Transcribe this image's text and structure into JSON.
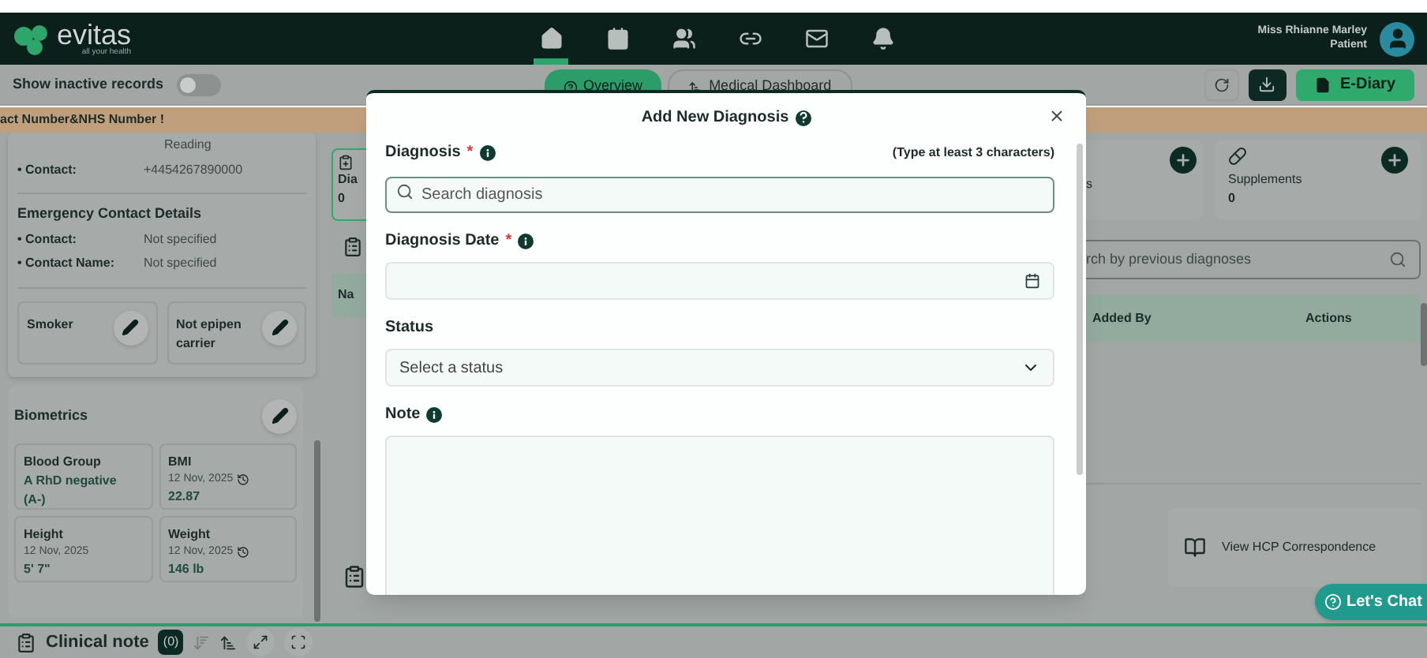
{
  "header": {
    "logo": "evitas",
    "tagline": "all your health",
    "nav": [
      {
        "kind": "home",
        "selected": true
      },
      {
        "kind": "calendar",
        "selected": false
      },
      {
        "kind": "people",
        "selected": false
      },
      {
        "kind": "link",
        "selected": false
      },
      {
        "kind": "mail",
        "selected": false
      },
      {
        "kind": "bell",
        "selected": false
      }
    ],
    "user": {
      "name": "Miss Rhianne Marley",
      "role": "Patient"
    }
  },
  "toolbar": {
    "inactive_toggle": {
      "label": "Show inactive records",
      "on": false
    },
    "tabs": [
      {
        "label": "Overview",
        "selected": true
      },
      {
        "label": "Medical Dashboard",
        "selected": false
      }
    ],
    "e_diary": "E-Diary"
  },
  "banner": "act Number&NHS Number !",
  "contact": {
    "reading": "Reading",
    "rows": [
      {
        "label": "• Contact:",
        "value": "+4454267890000"
      }
    ]
  },
  "emergency": {
    "title": "Emergency Contact Details",
    "rows": [
      {
        "label": "• Contact:",
        "value": "Not specified"
      },
      {
        "label": "• Contact Name:",
        "value": "Not specified"
      }
    ]
  },
  "flags": [
    "Smoker",
    "Not epipen carrier"
  ],
  "biometrics": {
    "title": "Biometrics",
    "items": [
      {
        "label": "Blood Group",
        "value": "A RhD negative (A-)",
        "history": false
      },
      {
        "label": "BMI",
        "date": "12 Nov, 2025",
        "value": "22.87",
        "history": true
      },
      {
        "label": "Height",
        "date": "12 Nov, 2025",
        "value": "5' 7\"",
        "history": false
      },
      {
        "label": "Weight",
        "date": "12 Nov, 2025",
        "value": "146 lb",
        "history": true
      }
    ]
  },
  "behind": {
    "tile_left": {
      "label": "Dia",
      "count": "0"
    },
    "table_left_header": "Na",
    "tile_right": {
      "label": "s"
    },
    "supplements": {
      "label": "Supplements",
      "count": "0"
    },
    "search_placeholder": "rch by previous diagnoses",
    "table_columns": [
      "Added By",
      "Actions"
    ],
    "correspondence": "View HCP Correspondence"
  },
  "chat": "Let's Chat",
  "clinical_note": {
    "title": "Clinical note",
    "count": "(0)"
  },
  "modal": {
    "title": "Add New Diagnosis",
    "fields": [
      {
        "kind": "search",
        "label": "Diagnosis",
        "required_mark": "*",
        "info": true,
        "hint": "(Type at least 3 characters)",
        "placeholder": "Search diagnosis"
      },
      {
        "kind": "date",
        "label": "Diagnosis Date",
        "required_mark": "*",
        "info": true
      },
      {
        "kind": "select",
        "label": "Status",
        "info": false,
        "placeholder": "Select a status"
      },
      {
        "kind": "textarea",
        "label": "Note",
        "info": true
      }
    ]
  }
}
